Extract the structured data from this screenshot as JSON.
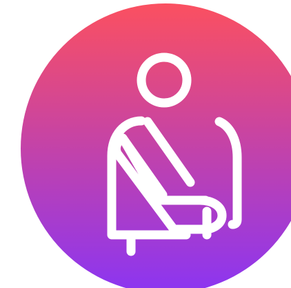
{
  "icon": {
    "name": "arm-sling-icon",
    "gradient_top": "#FB5060",
    "gradient_bottom": "#8B35F2",
    "stroke_color": "#FFFFFF"
  }
}
